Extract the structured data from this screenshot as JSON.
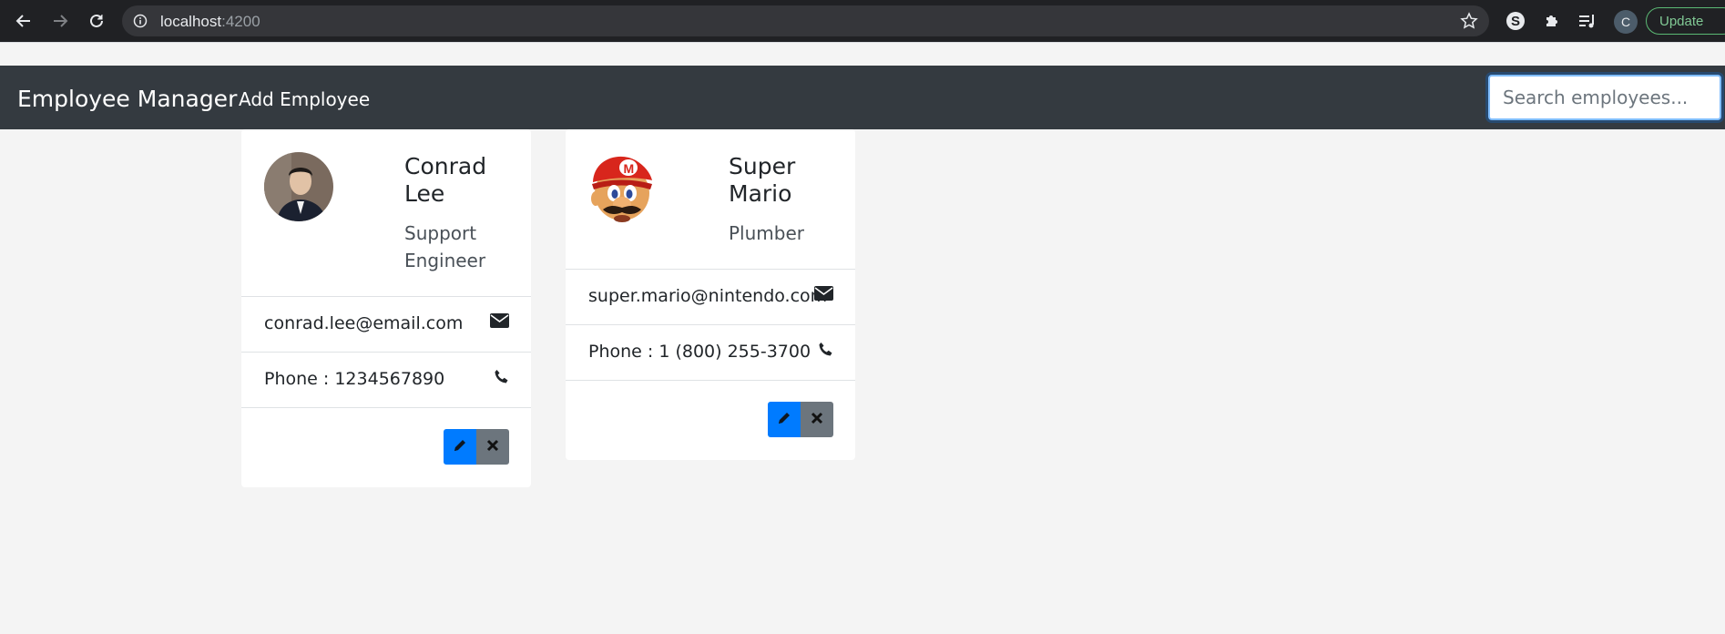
{
  "browser": {
    "url_host": "localhost",
    "url_port": ":4200",
    "profile_initial": "C",
    "update_label": "Update"
  },
  "navbar": {
    "brand": "Employee Manager",
    "add_link": "Add Employee",
    "search_placeholder": "Search employees..."
  },
  "employees": [
    {
      "name": "Conrad Lee",
      "job_title": "Support Engineer",
      "email": "conrad.lee@email.com",
      "phone": "Phone : 1234567890"
    },
    {
      "name": "Super Mario",
      "job_title": "Plumber",
      "email": "super.mario@nintendo.com",
      "phone": "Phone : 1 (800) 255-3700"
    }
  ],
  "colors": {
    "navbar_bg": "#343a40",
    "edit_button": "#007bff",
    "delete_button": "#6c757d",
    "page_bg": "#f4f4f4"
  }
}
